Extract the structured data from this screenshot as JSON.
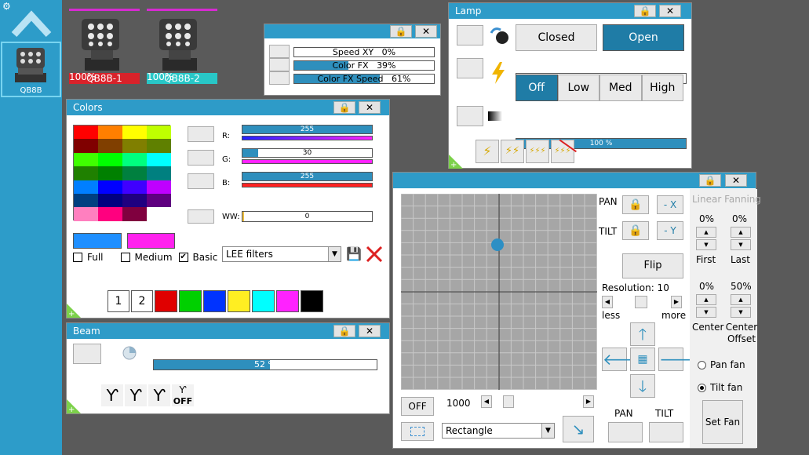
{
  "sidebar": {
    "gear_icon": "gear-icon",
    "fixture": {
      "label": "QB8B"
    }
  },
  "fixtures": [
    {
      "name": "QB8B-1",
      "percent": "100%",
      "name_color": "#d9222a"
    },
    {
      "name": "QB8B-2",
      "percent": "100%",
      "name_color": "#28c7c7"
    }
  ],
  "speed_window": {
    "rows": [
      {
        "label": "Speed XY",
        "value": "0%",
        "fill": 0
      },
      {
        "label": "Color FX",
        "value": "39%",
        "fill": 0.39
      },
      {
        "label": "Color FX Speed",
        "value": "61%",
        "fill": 0.61
      }
    ]
  },
  "lamp_window": {
    "title": "Lamp",
    "closed_label": "Closed",
    "open_label": "Open",
    "middle_bar_value": "0 %",
    "power_buttons": [
      "Off",
      "Low",
      "Med",
      "High"
    ],
    "bottom_bar_value": "100 %",
    "bottom_fill": 1.0
  },
  "colors_window": {
    "title": "Colors",
    "channels": [
      {
        "label": "R:",
        "value": "255",
        "fill": 1.0,
        "grad": "linear-gradient(90deg,#2222ff,#ff22ff)"
      },
      {
        "label": "G:",
        "value": "30",
        "fill": 0.12,
        "grad": "linear-gradient(90deg,#ff22ff,#ff22ff)"
      },
      {
        "label": "B:",
        "value": "255",
        "fill": 1.0,
        "grad": "linear-gradient(90deg,#ff2222,#ff2222)"
      },
      {
        "label": "WW:",
        "value": "0",
        "fill": 0,
        "grad": ""
      }
    ],
    "palette": [
      [
        "#ff0000",
        "#ff7f00",
        "#ffff00",
        "#bfff00"
      ],
      [
        "#800000",
        "#803f00",
        "#807f00",
        "#5f8000"
      ],
      [
        "#3fff00",
        "#00ff00",
        "#00ff7f",
        "#00ffff"
      ],
      [
        "#1f8000",
        "#008000",
        "#00803f",
        "#008080"
      ],
      [
        "#007fff",
        "#0000ff",
        "#3f00ff",
        "#bf00ff"
      ],
      [
        "#003f80",
        "#000080",
        "#1f0080",
        "#5f0080"
      ],
      [
        "#ff7fbf",
        "#ff007f",
        "#80003f",
        "#ffffff"
      ]
    ],
    "selected_color_1": "#1f8fff",
    "selected_color_2": "#ff22ee",
    "checks": [
      {
        "label": "Full",
        "checked": false
      },
      {
        "label": "Medium",
        "checked": false
      },
      {
        "label": "Basic",
        "checked": true
      }
    ],
    "filter_select": "LEE filters",
    "preset_labels": [
      "1",
      "2"
    ],
    "preset_colors": [
      "#e00000",
      "#00d000",
      "#0033ff",
      "#ffee22",
      "#00ffff",
      "#ff22ff",
      "#000000"
    ]
  },
  "beam_window": {
    "title": "Beam",
    "bar_value": "52 %",
    "fill": 0.52,
    "gobo_labels": [
      "",
      "",
      "",
      "OFF"
    ]
  },
  "position_window": {
    "pan_label": "PAN",
    "tilt_label": "TILT",
    "neg_x_label": "- X",
    "neg_y_label": "- Y",
    "flip_label": "Flip",
    "resolution_label": "Resolution: 10",
    "less_label": "less",
    "more_label": "more",
    "off_label": "OFF",
    "speed_value": "1000",
    "shape_select": "Rectangle",
    "pan_btn_label": "PAN",
    "tilt_btn_label": "TILT",
    "dot_color": "#2d8fc4",
    "fanning": {
      "title": "Linear Fanning",
      "first_value": "0%",
      "last_value": "0%",
      "first_label": "First",
      "last_label": "Last",
      "center_value": "0%",
      "offset_value": "50%",
      "center_label": "Center",
      "offset_label": "Center Offset",
      "pan_fan_label": "Pan fan",
      "tilt_fan_label": "Tilt fan",
      "set_fan_label": "Set Fan"
    }
  }
}
